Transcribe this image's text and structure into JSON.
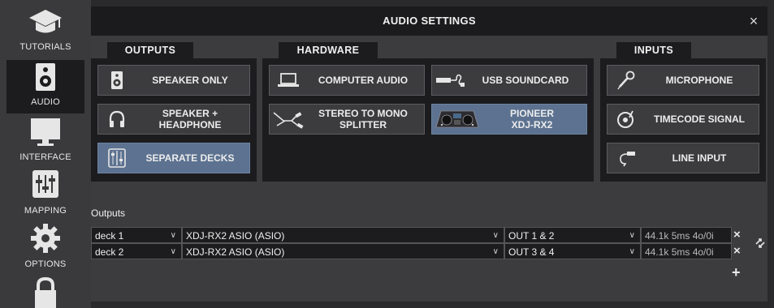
{
  "sidebar": {
    "items": [
      {
        "label": "TUTORIALS",
        "icon": "graduation-cap-icon"
      },
      {
        "label": "AUDIO",
        "icon": "speaker-icon",
        "active": true
      },
      {
        "label": "INTERFACE",
        "icon": "monitor-icon"
      },
      {
        "label": "MAPPING",
        "icon": "sliders-icon"
      },
      {
        "label": "OPTIONS",
        "icon": "gear-icon"
      },
      {
        "label": "",
        "icon": "lock-icon"
      }
    ]
  },
  "window": {
    "title": "AUDIO SETTINGS",
    "close_label": "×"
  },
  "outputs_section": {
    "tab": "OUTPUTS",
    "buttons": [
      {
        "label": "SPEAKER ONLY",
        "icon": "speaker-icon"
      },
      {
        "label": "SPEAKER +\nHEADPHONE",
        "icon": "headphone-icon"
      },
      {
        "label": "SEPARATE DECKS",
        "icon": "separate-decks-icon",
        "active": true
      }
    ]
  },
  "hardware_section": {
    "tab": "HARDWARE",
    "buttons": [
      {
        "label": "COMPUTER AUDIO",
        "icon": "laptop-icon"
      },
      {
        "label": "USB SOUNDCARD",
        "icon": "usb-soundcard-icon"
      },
      {
        "label": "STEREO TO MONO\nSPLITTER",
        "icon": "splitter-cable-icon"
      },
      {
        "label": "PIONEER\nXDJ-RX2",
        "icon": "pioneer-controller-icon",
        "active": true
      }
    ]
  },
  "inputs_section": {
    "tab": "INPUTS",
    "buttons": [
      {
        "label": "MICROPHONE",
        "icon": "microphone-icon"
      },
      {
        "label": "TIMECODE SIGNAL",
        "icon": "vinyl-icon"
      },
      {
        "label": "LINE INPUT",
        "icon": "jack-cable-icon"
      }
    ]
  },
  "outputs_table": {
    "label": "Outputs",
    "rows": [
      {
        "channel": "deck 1",
        "device": "XDJ-RX2 ASIO (ASIO)",
        "output": "OUT 1 & 2",
        "info": "44.1k 5ms 4o/0i"
      },
      {
        "channel": "deck 2",
        "device": "XDJ-RX2 ASIO (ASIO)",
        "output": "OUT 3 & 4",
        "info": "44.1k 5ms 4o/0i"
      }
    ],
    "remove_label": "×",
    "add_label": "+"
  },
  "colors": {
    "active_button": "#5c7290",
    "panel_dark": "#1c1c1e",
    "background": "#3c3c3e"
  }
}
